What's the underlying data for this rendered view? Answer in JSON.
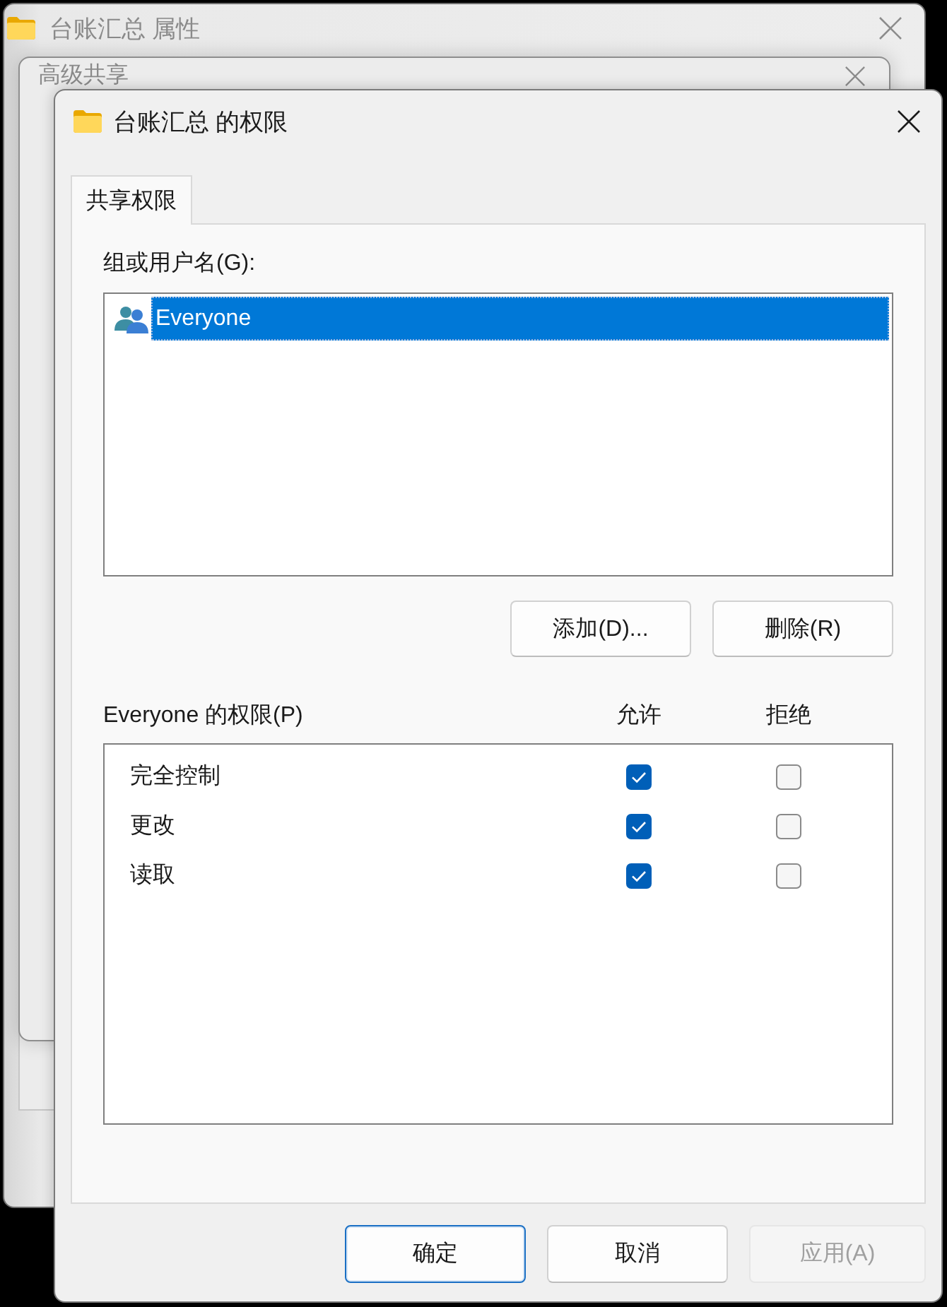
{
  "properties_window": {
    "title": "台账汇总 属性"
  },
  "advanced_sharing_window": {
    "title": "高级共享"
  },
  "dialog": {
    "title": "台账汇总 的权限",
    "tabs": [
      {
        "label": "共享权限",
        "selected": true
      }
    ],
    "users_label": "组或用户名(G):",
    "users": [
      {
        "name": "Everyone",
        "selected": true
      }
    ],
    "user_buttons": [
      {
        "label": "添加(D)..."
      },
      {
        "label": "删除(R)"
      }
    ],
    "permissions": {
      "label": "Everyone 的权限(P)",
      "columns": [
        "允许",
        "拒绝"
      ],
      "rows": [
        {
          "name": "完全控制",
          "allow": true,
          "deny": false
        },
        {
          "name": "更改",
          "allow": true,
          "deny": false
        },
        {
          "name": "读取",
          "allow": true,
          "deny": false
        }
      ]
    },
    "buttons": [
      {
        "label": "确定",
        "default": true,
        "disabled": false
      },
      {
        "label": "取消",
        "default": false,
        "disabled": false
      },
      {
        "label": "应用(A)",
        "default": false,
        "disabled": true
      }
    ]
  }
}
